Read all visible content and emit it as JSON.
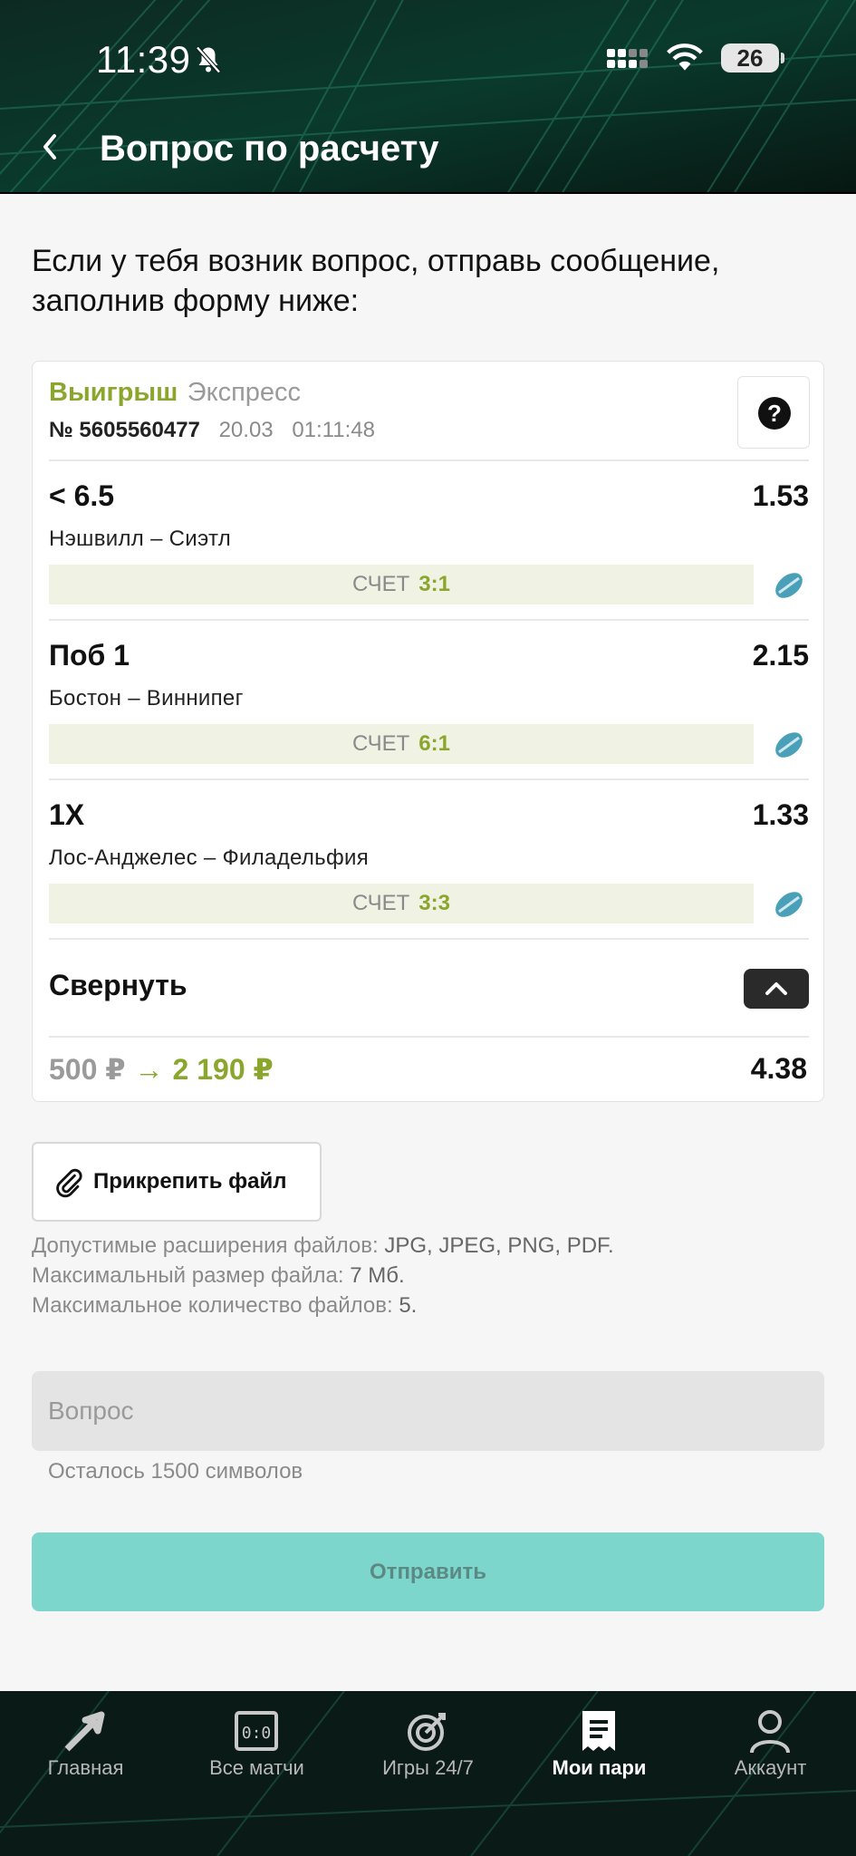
{
  "status_bar": {
    "time": "11:39",
    "battery": "26"
  },
  "header": {
    "title": "Вопрос по расчету"
  },
  "intro": "Если у тебя возник вопрос, отправь сообщение, заполнив форму ниже:",
  "bet_card": {
    "result": "Выигрыш",
    "type": "Экспресс",
    "number": "№ 5605560477",
    "date": "20.03",
    "time": "01:11:48",
    "help_icon": "question-icon",
    "score_label": "СЧЕТ",
    "events": [
      {
        "name": "< 6.5",
        "odds": "1.53",
        "match": "Нэшвилл – Сиэтл",
        "score": "3:1"
      },
      {
        "name": "Поб 1",
        "odds": "2.15",
        "match": "Бостон – Виннипег",
        "score": "6:1"
      },
      {
        "name": "1X",
        "odds": "1.33",
        "match": "Лос-Анджелес – Филадельфия",
        "score": "3:3"
      }
    ],
    "collapse_label": "Свернуть",
    "stake": "500 ₽",
    "arrow": "→",
    "payout": "2 190 ₽",
    "total_odds": "4.38"
  },
  "attach": {
    "label": "Прикрепить файл",
    "hint_1_prefix": "Допустимые расширения файлов: ",
    "hint_1_value": "JPG, JPEG, PNG, PDF.",
    "hint_2_prefix": "Максимальный размер файла: ",
    "hint_2_value": "7 Мб.",
    "hint_3_prefix": "Максимальное количество файлов: ",
    "hint_3_value": "5."
  },
  "question": {
    "placeholder": "Вопрос",
    "value": "",
    "remaining": "Осталось 1500 символов"
  },
  "send_label": "Отправить",
  "colors": {
    "accent_green": "#8aa62c",
    "send_button": "#7dd6cc",
    "header_bg": "#0a1a16"
  },
  "bottom_nav": [
    {
      "label": "Главная",
      "icon": "home-arrow-icon"
    },
    {
      "label": "Все матчи",
      "icon": "scoreboard-icon"
    },
    {
      "label": "Игры 24/7",
      "icon": "target-icon"
    },
    {
      "label": "Мои пари",
      "icon": "receipt-icon",
      "active": true
    },
    {
      "label": "Аккаунт",
      "icon": "user-icon"
    }
  ]
}
